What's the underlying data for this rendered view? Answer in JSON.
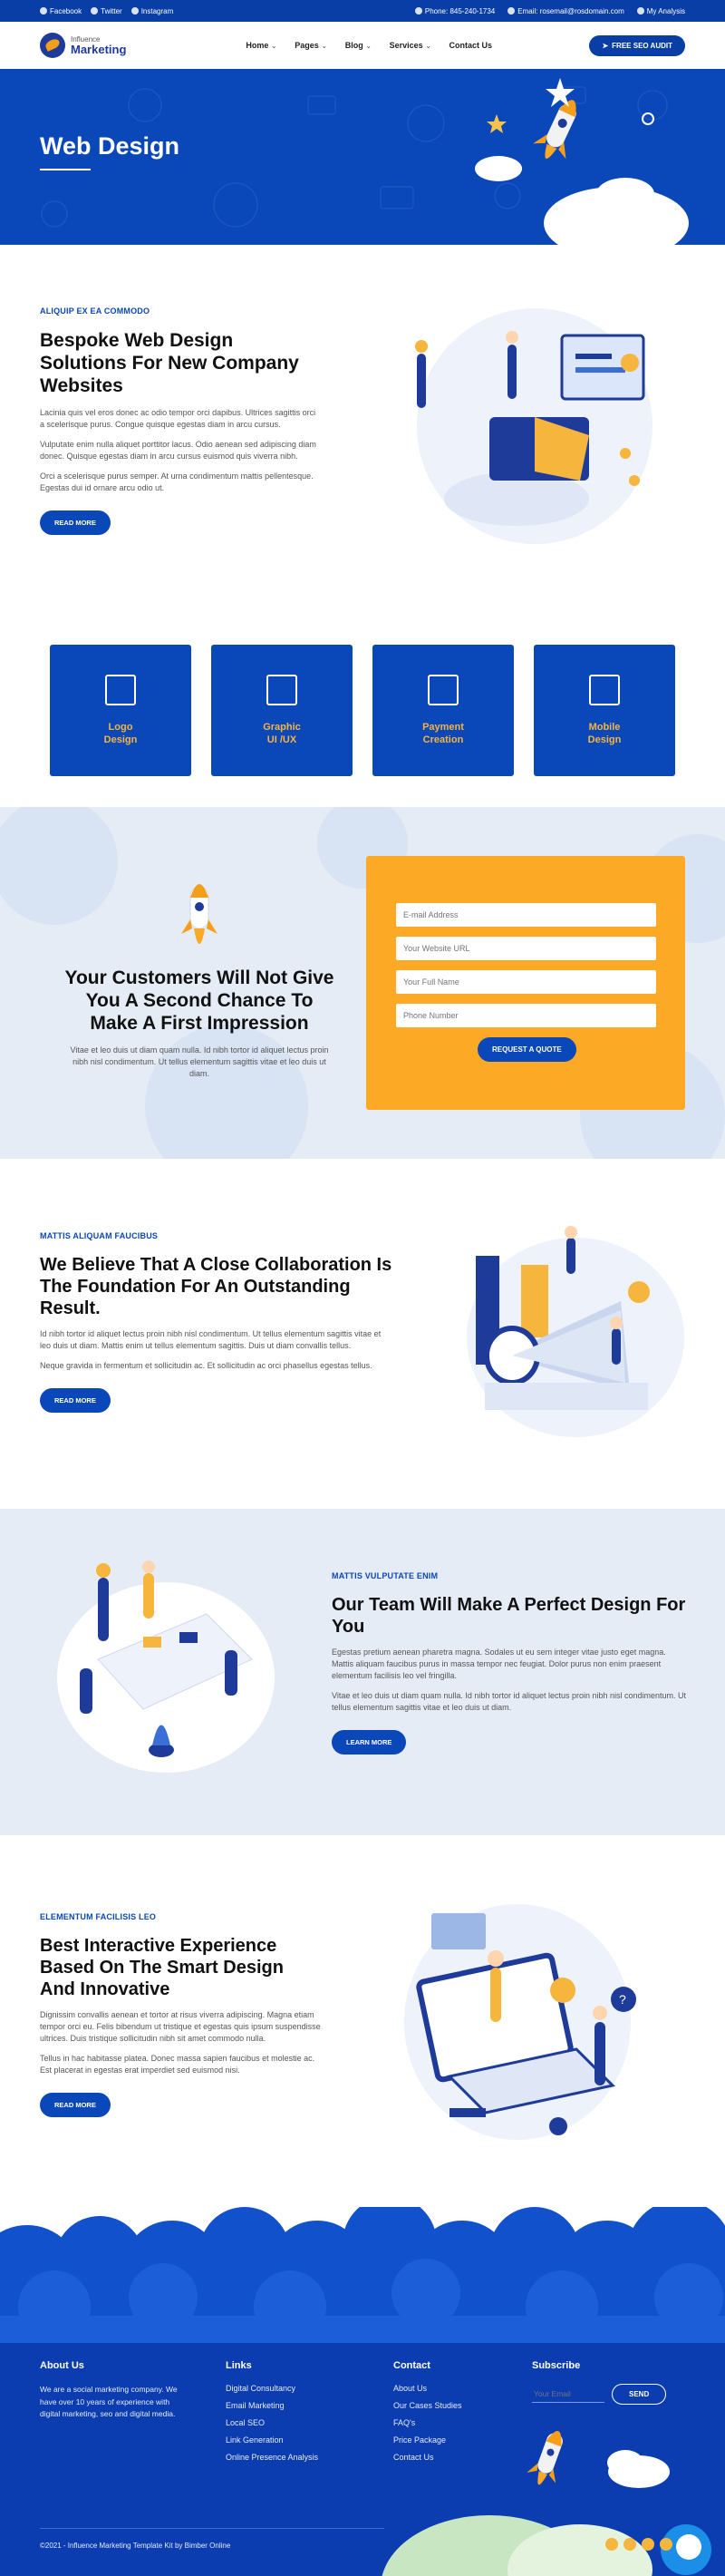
{
  "topbar": {
    "facebook": "Facebook",
    "twitter": "Twitter",
    "instagram": "Instagram",
    "phone": "Phone: 845-240-1734",
    "email": "Email: rosemail@rosdomain.com",
    "account": "My Analysis"
  },
  "logo": {
    "line1": "Influence",
    "line2": "Marketing"
  },
  "nav": {
    "items": [
      {
        "label": "Home",
        "caret": "⌄"
      },
      {
        "label": "Pages",
        "caret": "⌄"
      },
      {
        "label": "Blog",
        "caret": "⌄"
      },
      {
        "label": "Services",
        "caret": "⌄"
      },
      {
        "label": "Contact Us",
        "caret": ""
      }
    ],
    "cta": "FREE SEO AUDIT"
  },
  "hero": {
    "title": "Web Design"
  },
  "intro": {
    "kicker": "ALIQUIP EX EA COMMODO",
    "title": "Bespoke Web Design Solutions For New Company Websites",
    "p1": "Lacinia quis vel eros donec ac odio tempor orci dapibus. Ultrices sagittis orci a scelerisque purus. Congue quisque egestas diam in arcu cursus.",
    "p2": "Vulputate enim nulla aliquet porttitor lacus. Odio aenean sed adipiscing diam donec. Quisque egestas diam in arcu cursus euismod quis viverra nibh.",
    "p3": "Orci a scelerisque purus semper. At urna condimentum mattis pellentesque. Egestas dui id ornare arcu odio ut.",
    "button": "READ MORE"
  },
  "services": [
    {
      "l1": "Logo",
      "l2": "Design",
      "icon": "logo-design-icon"
    },
    {
      "l1": "Graphic",
      "l2": "UI /UX",
      "icon": "graphic-ui-icon"
    },
    {
      "l1": "Payment",
      "l2": "Creation",
      "icon": "payment-icon"
    },
    {
      "l1": "Mobile",
      "l2": "Design",
      "icon": "mobile-design-icon"
    }
  ],
  "quote": {
    "title": "Your Customers Will Not Give You A Second Chance To Make A First Impression",
    "text": "Vitae et leo duis ut diam quam nulla. Id nibh tortor id aliquet lectus proin nibh nisl condimentum. Ut tellus elementum sagittis vitae et leo duis ut diam.",
    "fields": [
      "E-mail Address",
      "Your Website URL",
      "Your Full Name",
      "Phone Number"
    ],
    "button": "REQUEST A QUOTE"
  },
  "collab": {
    "kicker": "MATTIS ALIQUAM FAUCIBUS",
    "title": "We Believe That A Close Collaboration Is The Foundation For An Outstanding Result.",
    "p1": "Id nibh tortor id aliquet lectus proin nibh nisl condimentum. Ut tellus elementum sagittis vitae et leo duis ut diam. Mattis enim ut tellus elementum sagittis. Duis ut diam convallis tellus.",
    "p2": "Neque gravida in fermentum et sollicitudin ac. Et sollicitudin ac orci phasellus egestas tellus.",
    "button": "READ MORE"
  },
  "team": {
    "kicker": "MATTIS VULPUTATE ENIM",
    "title": "Our Team Will Make A Perfect Design For You",
    "p1": "Egestas pretium aenean pharetra magna. Sodales ut eu sem integer vitae justo eget magna. Mattis aliquam faucibus purus in massa tempor nec feugiat. Dolor purus non enim praesent elementum facilisis leo vel fringilla.",
    "p2": "Vitae et leo duis ut diam quam nulla. Id nibh tortor id aliquet lectus proin nibh nisl condimentum. Ut tellus elementum sagittis vitae et leo duis ut diam.",
    "button": "LEARN MORE"
  },
  "experience": {
    "kicker": "ELEMENTUM FACILISIS LEO",
    "title": "Best Interactive Experience Based On The Smart Design And Innovative",
    "p1": "Dignissim convallis aenean et tortor at risus viverra adipiscing. Magna etiam tempor orci eu. Felis bibendum ut tristique et egestas quis ipsum suspendisse ultrices. Duis tristique sollicitudin nibh sit amet commodo nulla.",
    "p2": "Tellus in hac habitasse platea. Donec massa sapien faucibus et molestie ac. Est placerat in egestas erat imperdiet sed euismod nisi.",
    "button": "READ MORE"
  },
  "footer": {
    "about_title": "About Us",
    "about_text": "We are a social marketing company. We have over 10 years of experience with digital marketing, seo and digital media.",
    "links_title": "Links",
    "links": [
      "Digital Consultancy",
      "Email Marketing",
      "Local SEO",
      "Link Generation",
      "Online Presence Analysis"
    ],
    "contact_title": "Contact",
    "contact": [
      "About Us",
      "Our Cases Studies",
      "FAQ's",
      "Price Package",
      "Contact Us"
    ],
    "subscribe_title": "Subscribe",
    "email_placeholder": "Your Email",
    "send": "SEND",
    "copyright": "©2021 - Influence Marketing Template Kit by Bimber Online"
  },
  "colors": {
    "primary": "#0a47b8",
    "accent": "#fca926",
    "light_bg": "#e5ecf6"
  }
}
